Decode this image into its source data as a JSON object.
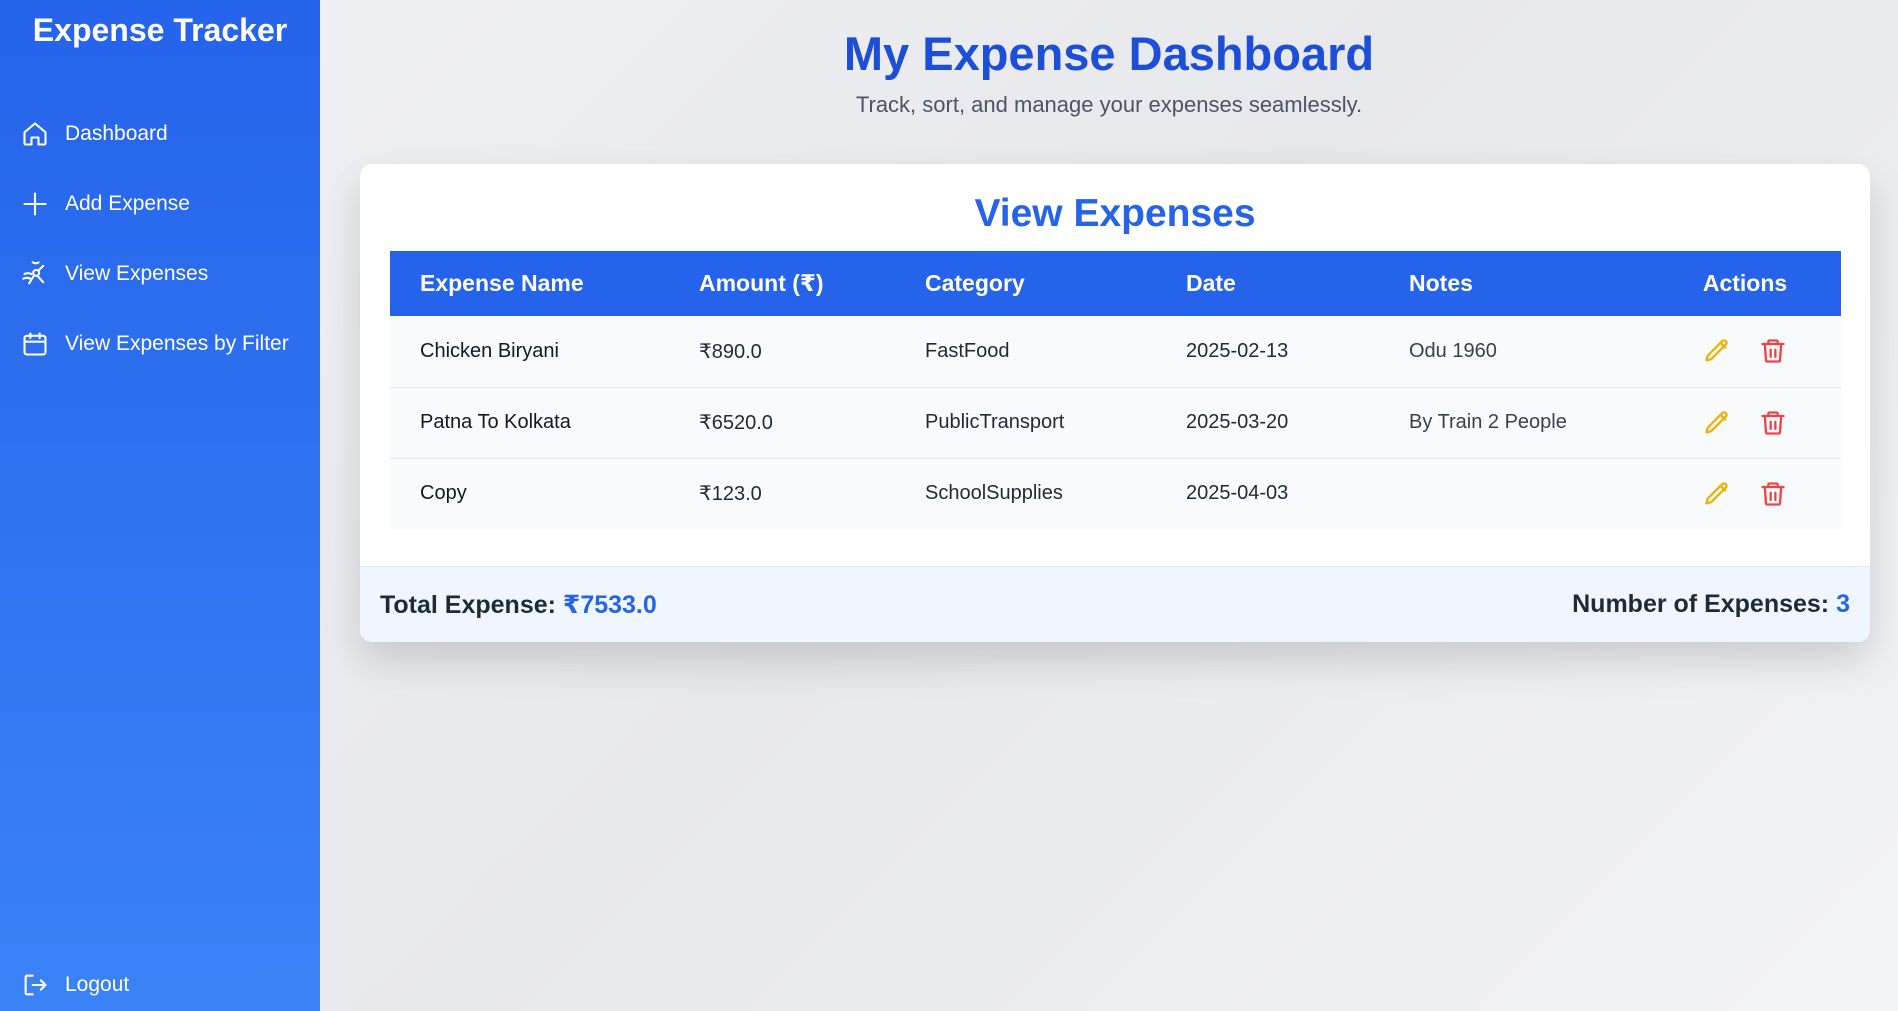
{
  "sidebar": {
    "brand": "Expense Tracker",
    "items": [
      {
        "label": "Dashboard",
        "icon": "home-icon"
      },
      {
        "label": "Add Expense",
        "icon": "plus-icon"
      },
      {
        "label": "View Expenses",
        "icon": "activity-icon"
      },
      {
        "label": "View Expenses by Filter",
        "icon": "calendar-icon"
      }
    ],
    "logout": {
      "label": "Logout",
      "icon": "logout-icon"
    }
  },
  "header": {
    "title": "My Expense Dashboard",
    "subtitle": "Track, sort, and manage your expenses seamlessly."
  },
  "card": {
    "title": "View Expenses",
    "columns": [
      "Expense Name",
      "Amount (₹)",
      "Category",
      "Date",
      "Notes",
      "Actions"
    ],
    "rows": [
      {
        "name": "Chicken Biryani",
        "amount": "₹890.0",
        "category": "FastFood",
        "date": "2025-02-13",
        "notes": "Odu 1960"
      },
      {
        "name": "Patna To Kolkata",
        "amount": "₹6520.0",
        "category": "PublicTransport",
        "date": "2025-03-20",
        "notes": "By Train 2 People"
      },
      {
        "name": "Copy",
        "amount": "₹123.0",
        "category": "SchoolSupplies",
        "date": "2025-04-03",
        "notes": ""
      }
    ],
    "footer": {
      "total_label": "Total Expense:",
      "total_value": "₹7533.0",
      "count_label": "Number of Expenses:",
      "count_value": "3"
    }
  },
  "colors": {
    "primary": "#2563eb",
    "edit": "#eab308",
    "delete": "#ef4444"
  }
}
